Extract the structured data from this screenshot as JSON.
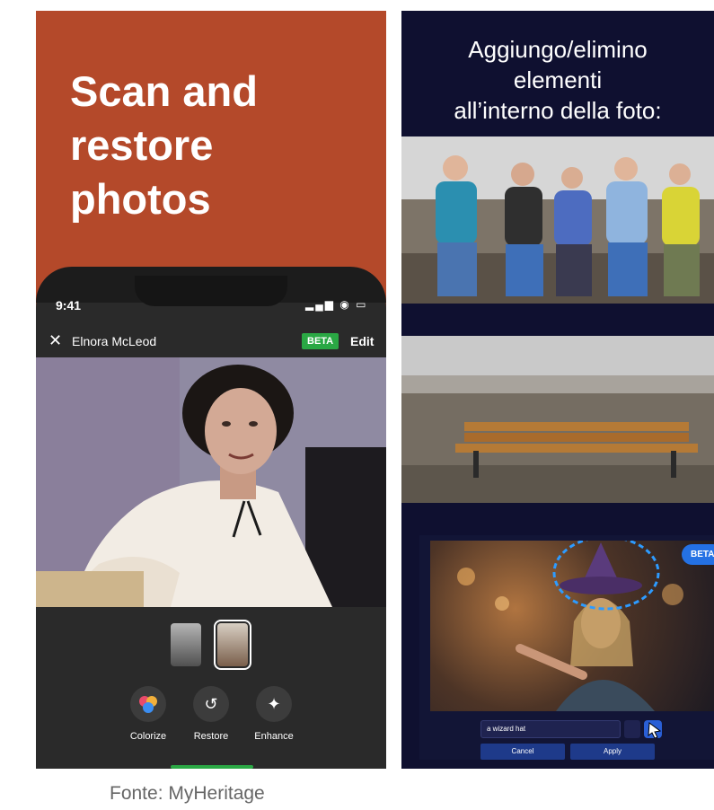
{
  "left_panel": {
    "headline": "Scan and\nrestore\nphotos",
    "status_time": "9:41",
    "status_icons": "▂▄▆ ◉ ▭",
    "nav_title": "Elnora McLeod",
    "beta_label": "BETA",
    "edit_label": "Edit",
    "close_glyph": "✕",
    "tools": [
      {
        "label": "Colorize",
        "icon": "colorize-icon"
      },
      {
        "label": "Restore",
        "icon": "restore-icon"
      },
      {
        "label": "Enhance",
        "icon": "enhance-icon"
      }
    ]
  },
  "right_panel": {
    "headline": "Aggiungo/elimino\nelementi\nall’interno della foto:",
    "beta_label": "BETA",
    "prompt_value": "a wizard hat",
    "cancel_label": "Cancel",
    "apply_label": "Apply"
  },
  "caption": "Fonte: MyHeritage",
  "colors": {
    "left_bg": "#b4492a",
    "right_bg": "#0f1030",
    "beta_green": "#2aa844",
    "beta_blue": "#2471e4"
  }
}
